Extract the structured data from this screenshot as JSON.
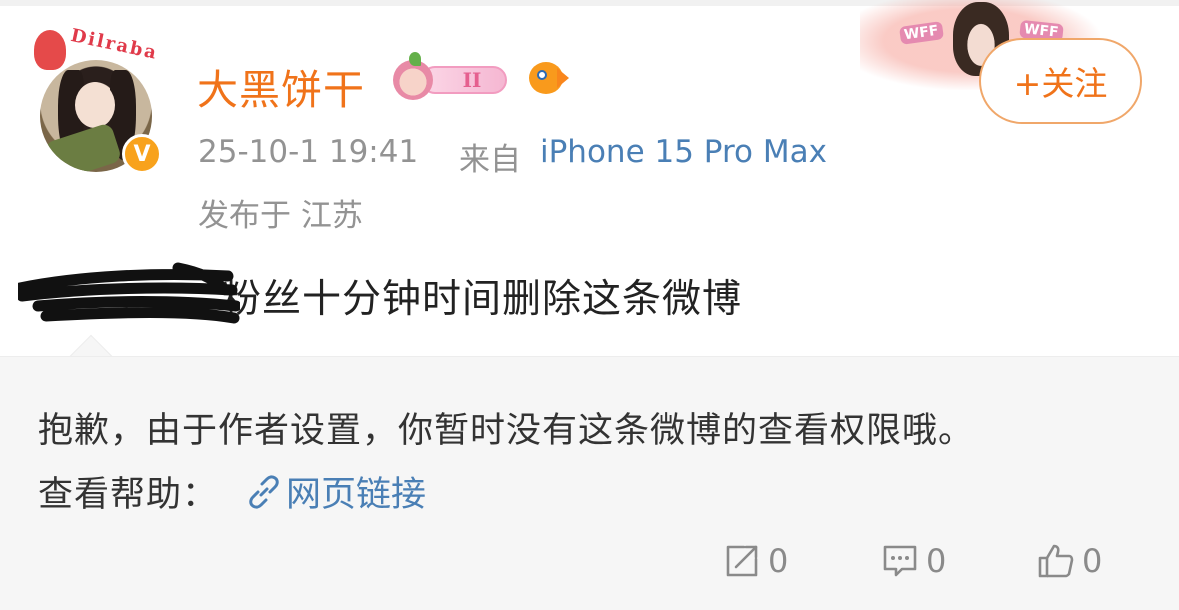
{
  "post": {
    "author": {
      "name": "大黑饼干",
      "avatar_deco_text": "Dilraba",
      "verified_mark": "V",
      "level_badge": "II",
      "fan_badge_text": "WFF"
    },
    "follow_label": "+关注",
    "time": "25-10-1 19:41",
    "source_prefix": "来自",
    "device": "iPhone 15 Pro Max",
    "location": "发布于 江苏",
    "text_visible": "粉丝十分钟时间删除这条微博"
  },
  "notice": {
    "message": "抱歉，由于作者设置，你暂时没有这条微博的查看权限哦。",
    "help_label": "查看帮助：",
    "help_link": "网页链接"
  },
  "actions": {
    "repost_count": "0",
    "comment_count": "0",
    "like_count": "0"
  },
  "colors": {
    "username": "#f0731a",
    "link": "#4a7fb5",
    "meta": "#939393",
    "notice_bg": "#f6f6f6"
  }
}
